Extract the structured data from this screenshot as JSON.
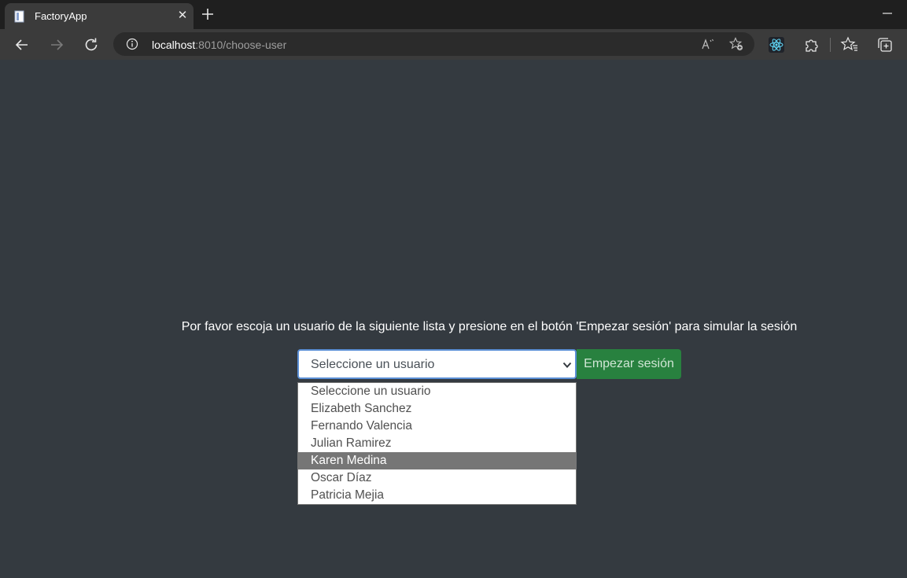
{
  "browser": {
    "tab_title": "FactoryApp",
    "url_host": "localhost",
    "url_rest": ":8010/choose-user"
  },
  "icons": {
    "favicon": "document-icon",
    "tab_close": "close-icon",
    "new_tab": "plus-icon",
    "minimize": "minimize-icon",
    "back": "arrow-left-icon",
    "forward": "arrow-right-icon",
    "refresh": "refresh-icon",
    "site_info": "info-icon",
    "read_aloud": "read-aloud-icon",
    "add_favorite": "star-add-icon",
    "react_devtools": "react-icon",
    "extensions": "puzzle-icon",
    "favorites": "favorites-icon",
    "collections": "collections-icon",
    "chevron": "chevron-down-icon"
  },
  "page": {
    "prompt": "Por favor escoja un usuario de la siguiente lista y presione en el botón 'Empezar sesión' para simular la sesión",
    "select_value": "Seleccione un usuario",
    "start_button": "Empezar sesión"
  },
  "dropdown": {
    "options": [
      "Seleccione un usuario",
      "Elizabeth Sanchez",
      "Fernando Valencia",
      "Julian Ramirez",
      "Karen Medina",
      "Oscar Díaz",
      "Patricia Mejia"
    ],
    "highlighted": "Karen Medina"
  },
  "colors": {
    "page_bg": "#343a40",
    "button_green": "#28813f",
    "select_focus": "#5b8fd6",
    "option_highlight": "#767676"
  }
}
